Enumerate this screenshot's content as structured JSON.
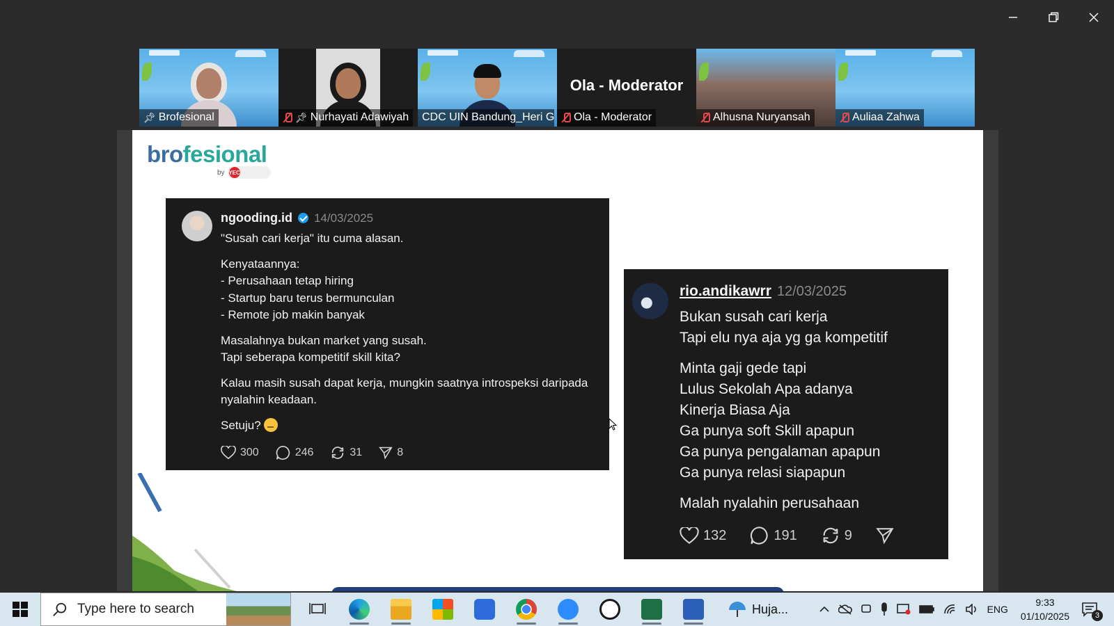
{
  "participants": [
    {
      "name": "Brofesional",
      "active": true,
      "muted": false,
      "pinned": true
    },
    {
      "name": "Nurhayati Adawiyah",
      "active": false,
      "muted": true,
      "pinned": true
    },
    {
      "name": "CDC UIN Bandung_Heri G...",
      "active": false,
      "muted": false,
      "pinned": false
    },
    {
      "name": "Ola - Moderator",
      "display": "Ola - Moderator",
      "active": false,
      "muted": true,
      "pinned": false
    },
    {
      "name": "Alhusna Nuryansah",
      "active": false,
      "muted": true,
      "pinned": false
    },
    {
      "name": "Auliaa Zahwa",
      "active": false,
      "muted": true,
      "pinned": false
    }
  ],
  "slide": {
    "logo_part1": "bro",
    "logo_part2": "fesi",
    "logo_part3": "nal",
    "logo_by": "by",
    "logo_badge": "YEC",
    "post1": {
      "username": "ngooding.id",
      "date": "14/03/2025",
      "lines": [
        "\"Susah cari kerja\" itu cuma alasan.",
        "",
        "Kenyataannya:",
        "- Perusahaan tetap hiring",
        "- Startup baru terus bermunculan",
        "- Remote job makin banyak",
        "",
        "Masalahnya bukan market yang susah.",
        "Tapi seberapa kompetitif skill kita?",
        "",
        "Kalau masih susah dapat kerja, mungkin saatnya introspeksi daripada nyalahin keadaan.",
        "",
        "Setuju?"
      ],
      "likes": "300",
      "comments": "246",
      "reposts": "31",
      "shares": "8"
    },
    "post2": {
      "username": "rio.andikawrr",
      "date": "12/03/2025",
      "lines": [
        "Bukan susah cari kerja",
        "Tapi elu nya aja yg ga kompetitif",
        "",
        "Minta gaji gede tapi",
        "Lulus Sekolah Apa adanya",
        "Kinerja Biasa Aja",
        "Ga punya soft Skill apapun",
        "Ga punya pengalaman apapun",
        "Ga punya relasi siapapun",
        "",
        "Malah nyalahin perusahaan"
      ],
      "likes": "132",
      "comments": "191",
      "reposts": "9"
    }
  },
  "taskbar": {
    "search_placeholder": "Type here to search",
    "weather": "Huja...",
    "language": "ENG",
    "time": "9:33",
    "date": "01/10/2025",
    "notification_count": "3"
  },
  "colors": {
    "active_border": "#23d160",
    "muted_red": "#e5484d",
    "verified_blue": "#1d9bf0",
    "logo_blue": "#3b6ea0",
    "logo_teal": "#28a89a"
  }
}
